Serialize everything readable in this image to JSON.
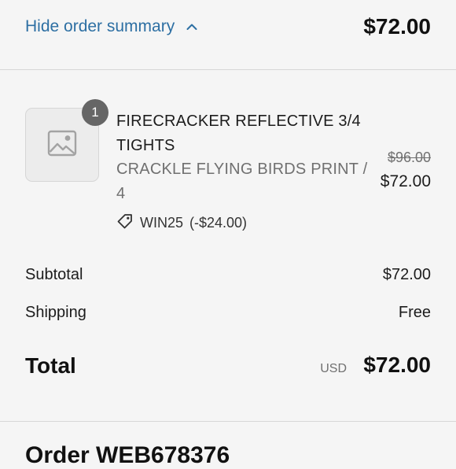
{
  "summary_toggle": {
    "label": "Hide order summary",
    "icon": "chevron-up-icon",
    "total": "$72.00"
  },
  "line_item": {
    "image_icon": "image-placeholder-icon",
    "quantity": "1",
    "name": "FIRECRACKER REFLECTIVE 3/4 TIGHTS",
    "variant": "CRACKLE FLYING BIRDS PRINT / 4",
    "discount_icon": "tag-icon",
    "discount_code": "WIN25",
    "discount_amount": "(-$24.00)",
    "original_price": "$96.00",
    "price": "$72.00"
  },
  "totals": {
    "subtotal_label": "Subtotal",
    "subtotal_value": "$72.00",
    "shipping_label": "Shipping",
    "shipping_value": "Free",
    "total_label": "Total",
    "currency": "USD",
    "total_value": "$72.00"
  },
  "order": {
    "heading": "Order WEB678376"
  },
  "colors": {
    "link": "#2d6fa3",
    "background": "#f5f5f5",
    "badge": "#666666",
    "muted_text": "#707070"
  }
}
